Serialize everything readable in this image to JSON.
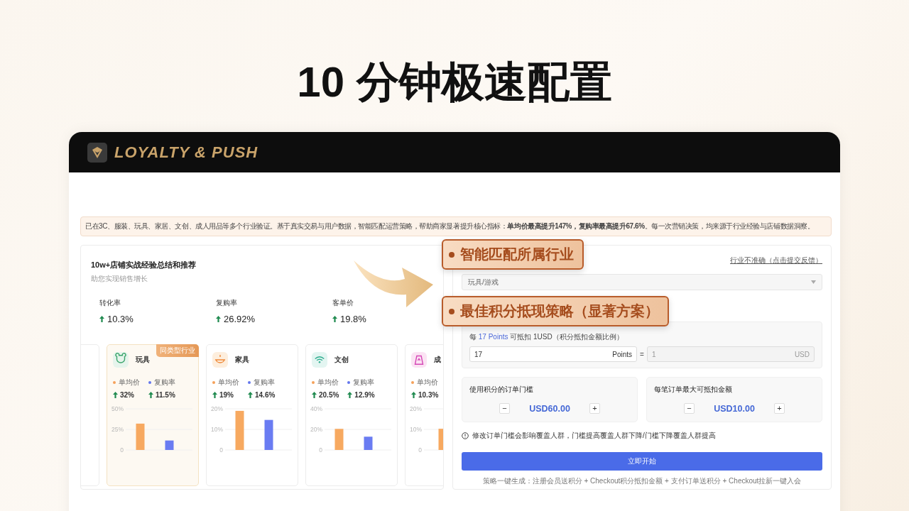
{
  "headline": "10 分钟极速配置",
  "app": {
    "brand": "LOYALTY & PUSH"
  },
  "banner": {
    "text": "已在3C、服装、玩具、家居、文创、成人用品等多个行业验证。基于真实交易与用户数据，智能匹配运营策略，帮助商家显著提升核心指标：**单均价最高提升147%，复购率最高提升67.6%**。每一次营销决策，均来源于行业经验与店铺数据洞察。"
  },
  "insights": {
    "title": "10w+店铺实战经验总结和推荐",
    "subtitle": "助您实现销售增长",
    "stats": [
      {
        "label": "转化率",
        "value": "10.3%"
      },
      {
        "label": "复购率",
        "value": "26.92%"
      },
      {
        "label": "客单价",
        "value": "19.8%"
      }
    ],
    "cards": [
      {
        "kind": "stub"
      },
      {
        "kind": "full",
        "title": "玩具",
        "badge": "同类型行业",
        "highlighted": true,
        "metrics": [
          {
            "label": "单均价",
            "value": "32%",
            "color": "#f5a15a"
          },
          {
            "label": "复购率",
            "value": "11.5%",
            "color": "#6477ee"
          }
        ],
        "chart_data": {
          "type": "bar",
          "series": [
            {
              "color": "#f7a960",
              "values": [
                32,
                null
              ]
            },
            {
              "color": "#6a7cf2",
              "values": [
                null,
                11.5
              ]
            }
          ],
          "ylim": [
            0,
            50
          ],
          "yticks": [
            {
              "value": 0,
              "label": "0"
            },
            {
              "value": 25,
              "label": "25%"
            },
            {
              "value": 50,
              "label": "50%"
            }
          ]
        }
      },
      {
        "kind": "full",
        "title": "家具",
        "highlighted": false,
        "metrics": [
          {
            "label": "单均价",
            "value": "19%",
            "color": "#f5a15a"
          },
          {
            "label": "复购率",
            "value": "14.6%",
            "color": "#6477ee"
          }
        ],
        "chart_data": {
          "type": "bar",
          "series": [
            {
              "color": "#f7a960",
              "values": [
                19,
                null
              ]
            },
            {
              "color": "#6a7cf2",
              "values": [
                null,
                14.6
              ]
            }
          ],
          "ylim": [
            0,
            20
          ],
          "yticks": [
            {
              "value": 0,
              "label": "0"
            },
            {
              "value": 10,
              "label": "10%"
            },
            {
              "value": 20,
              "label": "20%"
            }
          ]
        }
      },
      {
        "kind": "full",
        "title": "文创",
        "highlighted": false,
        "metrics": [
          {
            "label": "单均价",
            "value": "20.5%",
            "color": "#f5a15a"
          },
          {
            "label": "复购率",
            "value": "12.9%",
            "color": "#6477ee"
          }
        ],
        "chart_data": {
          "type": "bar",
          "series": [
            {
              "color": "#f7a960",
              "values": [
                20.5,
                null
              ]
            },
            {
              "color": "#6a7cf2",
              "values": [
                null,
                12.9
              ]
            }
          ],
          "ylim": [
            0,
            40
          ],
          "yticks": [
            {
              "value": 0,
              "label": "0"
            },
            {
              "value": 20,
              "label": "20%"
            },
            {
              "value": 40,
              "label": "40%"
            }
          ]
        }
      },
      {
        "kind": "cut",
        "title": "成",
        "highlighted": false,
        "metrics": [
          {
            "label": "单均价",
            "value": "10.3%",
            "color": "#f5a15a"
          }
        ],
        "chart_data": {
          "type": "bar",
          "series": [
            {
              "color": "#f7a960",
              "values": [
                10.3
              ]
            }
          ],
          "ylim": [
            0,
            20
          ],
          "yticks": [
            {
              "value": 0,
              "label": "0"
            },
            {
              "value": 10,
              "label": "10%"
            },
            {
              "value": 20,
              "label": "20%"
            }
          ]
        }
      }
    ]
  },
  "strategy": {
    "feedback_link": "行业不准确（点击提交反馈）",
    "industry_select": {
      "value": "玩具/游戏"
    },
    "ratio_label": {
      "prefix": "每",
      "highlight": "17 Points",
      "suffix": "可抵扣 1USD（积分抵扣金额比例）"
    },
    "points_field": {
      "value": "17",
      "unit": "Points",
      "disabled": false
    },
    "equals": "=",
    "usd_field": {
      "value": "1",
      "unit": "USD",
      "disabled": true
    },
    "steppers": [
      {
        "label": "使用积分的订单门槛",
        "minus": "−",
        "value": "USD60.00",
        "plus": "+"
      },
      {
        "label": "每笔订单最大可抵扣金额",
        "minus": "−",
        "value": "USD10.00",
        "plus": "+"
      }
    ],
    "note": "修改订单门槛会影响覆盖人群，门槛提高覆盖人群下降/门槛下降覆盖人群提高",
    "start_button": "立即开始",
    "footer": "策略一键生成：注册会员送积分 + Checkout积分抵扣金额 + 支付订单送积分 + Checkout拉新一键入会"
  },
  "callouts": [
    {
      "text": "智能匹配所属行业"
    },
    {
      "text": "最佳积分抵现策略（显著方案）"
    }
  ]
}
